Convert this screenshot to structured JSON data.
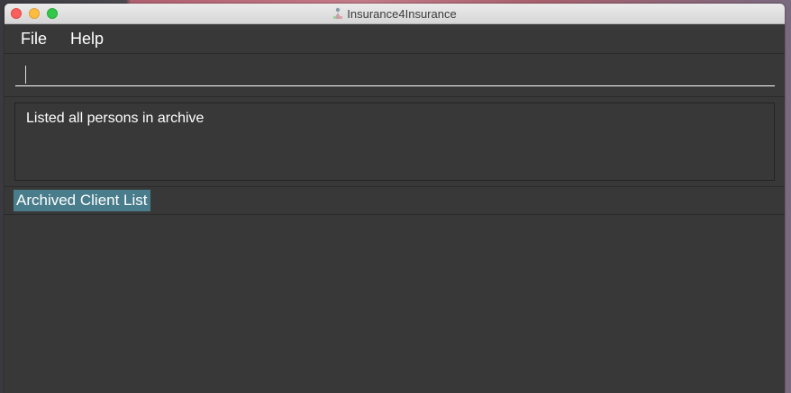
{
  "window": {
    "title": "Insurance4Insurance"
  },
  "menu": {
    "items": [
      "File",
      "Help"
    ]
  },
  "command": {
    "value": ""
  },
  "result": {
    "message": "Listed all persons in archive"
  },
  "list": {
    "header": "Archived Client List"
  },
  "colors": {
    "background": "#383838",
    "accent": "#4a7d8c",
    "text": "#ffffff"
  }
}
